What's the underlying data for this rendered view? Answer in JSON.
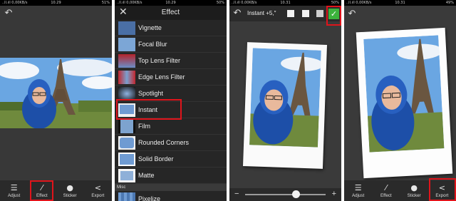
{
  "status": {
    "left": "..ll.ıll 0,00KB/s",
    "p1": {
      "time": "10.29",
      "battery": "51%"
    },
    "p2": {
      "time": "10.29",
      "battery": "50%"
    },
    "p3": {
      "time": "10.31",
      "battery": "50%"
    },
    "p4": {
      "time": "10.31",
      "battery": "49%"
    }
  },
  "icons": {
    "undo": "undo-icon",
    "adjust": "sliders-icon",
    "effect": "magic-wand-icon",
    "sticker": "speech-bubble-icon",
    "export": "share-icon",
    "close": "close-icon",
    "check": "checkmark-icon"
  },
  "toolbar": {
    "adjust": "Adjust",
    "effect": "Effect",
    "sticker": "Sticker",
    "export": "Export"
  },
  "effect_panel": {
    "title": "Effect",
    "items": [
      "Vignette",
      "Focal Blur",
      "Top Lens Filter",
      "Edge Lens Filter",
      "Spotlight",
      "Instant",
      "Film",
      "Rounded Corners",
      "Solid Border",
      "Matte"
    ],
    "section": "Misc",
    "section_items": [
      "Pixelize"
    ],
    "selected": "Instant"
  },
  "instant_panel": {
    "label": "Instant +5,″",
    "slider_minus": "−",
    "slider_plus": "+",
    "slider_value": 0.63
  },
  "colors": {
    "highlight": "#e0141b",
    "accept": "#3cb23c"
  }
}
